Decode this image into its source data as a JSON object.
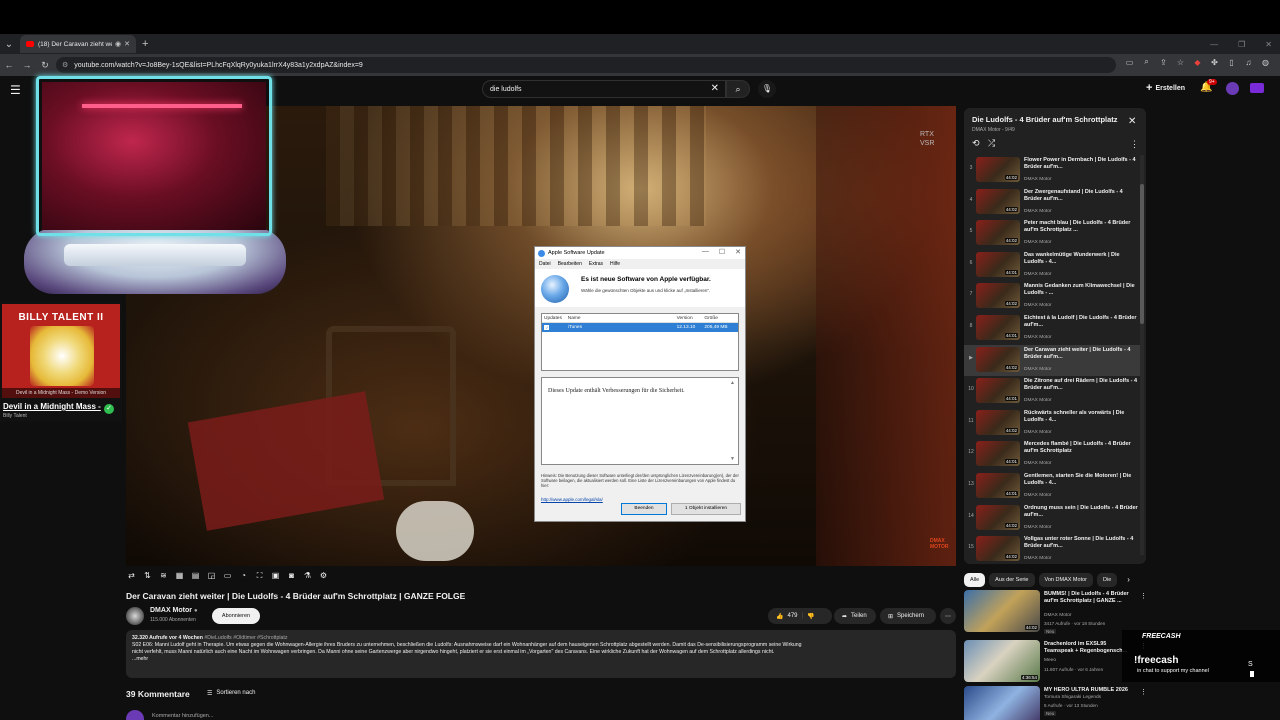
{
  "browser": {
    "tab_title": "(18) Der Caravan zieht weite",
    "url": "youtube.com/watch?v=Jo8Bey-1sQE&list=PLhcFqXlqRy0yuka1lrrX4y83a1y2xdpAZ&index=9"
  },
  "header": {
    "search_value": "die ludolfs",
    "create_label": "Erstellen",
    "notif_count": "9+"
  },
  "video": {
    "overlay_text": "RTX\nVSR",
    "watermark": "DMAX\nMOTOR"
  },
  "now_playing": {
    "album_text": "BILLY TALENT II",
    "caption": "Devil in a Midnight Mass - Demo Version",
    "song": "Devil in a Midnight Mass -",
    "artist": "Billy Talent"
  },
  "dialog": {
    "title": "Apple Software Update",
    "menu": [
      "Datei",
      "Bearbeiten",
      "Extras",
      "Hilfe"
    ],
    "heading": "Es ist neue Software von Apple verfügbar.",
    "subheading": "Wähle die gewünschten Objekte aus und klicke auf „Installieren\".",
    "columns": [
      "Updates",
      "Name",
      "Version",
      "Größe"
    ],
    "row": {
      "name": "iTunes",
      "version": "12.13.10",
      "size": "205,49 MB"
    },
    "description": "Dieses Update enthält Verbesserungen für die Sicherheit.",
    "notice": "Hinweis: Die Benutzung dieser Software unterliegt der/den ursprünglichen Lizenzvereinbarung(en), der der Software beilagen, die aktualisiert werden soll. Eine Liste der Lizenzvereinbarungen von Apple findest du hier:",
    "link": "http://www.apple.com/legal/sla/",
    "btn_quit": "Beenden",
    "btn_install": "1 Objekt installieren"
  },
  "watch": {
    "title": "Der Caravan zieht weiter | Die Ludolfs - 4 Brüder auf'm Schrottplatz | GANZE FOLGE",
    "channel": "DMAX Motor",
    "subs": "115.000 Abonnenten",
    "subscribe": "Abonnieren",
    "likes": "479",
    "share": "Teilen",
    "save": "Speichern",
    "desc_stats": "32.320 Aufrufe  vor 4 Wochen",
    "desc_tags": "#DieLudolfs #Oldtimer #Schrottplatz",
    "desc_line1": "S02 E06: Manni Ludolf geht in Therapie. Um etwas gegen die Wohnwagen-Allergie ihres Bruders zu unternehmen, beschließen die Ludolfs: Ausnahmsweise darf ein Wohnanhänger auf dem hauseigenen Schrottplatz abgestellt werden. Damit das De-sensibilisierungsprogramm seine Wirkung",
    "desc_line2": "nicht verfehlt, muss Manni natürlich auch eine Nacht im Wohnwagen verbringen. Da Manni ohne seine Gartenzwerge aber nirgendwo hingeht, platziert er sie erst einmal im „Vorgarten\" des Caravans. Eine wirkliche Zukunft hat der Wohnwagen auf dem Schrottplatz allerdings nicht.",
    "desc_more": "...mehr",
    "comments": "39 Kommentare",
    "sort": "Sortieren nach",
    "comment_placeholder": "Kommentar hinzufügen..."
  },
  "playlist": {
    "title": "Die Ludolfs - 4 Brüder auf'm Schrottplatz",
    "sub": "DMAX Motor - 9/49",
    "items": [
      {
        "idx": "3",
        "title": "Flower Power in Dernbach | Die Ludolfs - 4 Brüder auf'm...",
        "channel": "DMAX Motor",
        "duration": "44:02"
      },
      {
        "idx": "4",
        "title": "Der Zwergenaufstand | Die Ludolfs - 4 Brüder auf'm...",
        "channel": "DMAX Motor",
        "duration": "44:02"
      },
      {
        "idx": "5",
        "title": "Peter macht blau | Die Ludolfs - 4 Brüder auf'm Schrottplatz ...",
        "channel": "DMAX Motor",
        "duration": "44:02"
      },
      {
        "idx": "6",
        "title": "Das wankelmütige Wunderwerk | Die Ludolfs - 4...",
        "channel": "DMAX Motor",
        "duration": "44:01"
      },
      {
        "idx": "7",
        "title": "Mannis Gedanken zum Klimawechsel | Die Ludolfs - ...",
        "channel": "DMAX Motor",
        "duration": "44:02"
      },
      {
        "idx": "8",
        "title": "Eichtest à la Ludolf | Die Ludolfs - 4 Brüder auf'm...",
        "channel": "DMAX Motor",
        "duration": "44:01"
      },
      {
        "idx": "▶",
        "title": "Der Caravan zieht weiter | Die Ludolfs - 4 Brüder auf'm...",
        "channel": "DMAX Motor",
        "duration": "44:02"
      },
      {
        "idx": "10",
        "title": "Die Zitrone auf drei Rädern | Die Ludolfs - 4 Brüder auf'm...",
        "channel": "DMAX Motor",
        "duration": "44:01"
      },
      {
        "idx": "11",
        "title": "Rückwärts schneller als vorwärts | Die Ludolfs - 4...",
        "channel": "DMAX Motor",
        "duration": "44:02"
      },
      {
        "idx": "12",
        "title": "Mercedes flambé | Die Ludolfs - 4 Brüder auf'm Schrottplatz",
        "channel": "DMAX Motor",
        "duration": "44:01"
      },
      {
        "idx": "13",
        "title": "Gentlemen, starten Sie die Motoren! | Die Ludolfs - 4...",
        "channel": "DMAX Motor",
        "duration": "44:01"
      },
      {
        "idx": "14",
        "title": "Ordnung muss sein | Die Ludolfs - 4 Brüder auf'm...",
        "channel": "DMAX Motor",
        "duration": "44:02"
      },
      {
        "idx": "15",
        "title": "Vollgas unter roter Sonne | Die Ludolfs - 4 Brüder auf'm...",
        "channel": "DMAX Motor",
        "duration": "44:02"
      }
    ]
  },
  "chips": [
    "Alle",
    "Aus der Serie",
    "Von DMAX Motor",
    "Die"
  ],
  "recommendations": [
    {
      "title": "BUMMS! | Die Ludolfs - 4 Brüder auf'm Schrottplatz | GANZE ...",
      "channel": "DMAX Motor",
      "meta": "3417 Aufrufe · vor 18 Stunden",
      "badge": "Neu",
      "duration": "44:02"
    },
    {
      "title": "Drachenlord im EXSL95 Teamspeak + Regenbogensch...",
      "channel": "Meeo",
      "meta": "11.807 Aufrufe · vor 6 Jahren",
      "badge": "",
      "duration": "4:36:54"
    },
    {
      "title": "MY HERO ULTRA RUMBLE 2026",
      "channel": "Tomura Shigaraki Legends",
      "meta": "5 Aufrufe · vor 13 Stunden",
      "badge": "Neu",
      "duration": ""
    }
  ],
  "freecash": {
    "brand": "FREECASH",
    "handle": "!freecash",
    "message": "in chat to support my channel",
    "side": "S"
  },
  "colors": {
    "accent": "#ff0000",
    "dialog_select": "#2f7fd4",
    "cam_border": "#6fe0e8"
  }
}
